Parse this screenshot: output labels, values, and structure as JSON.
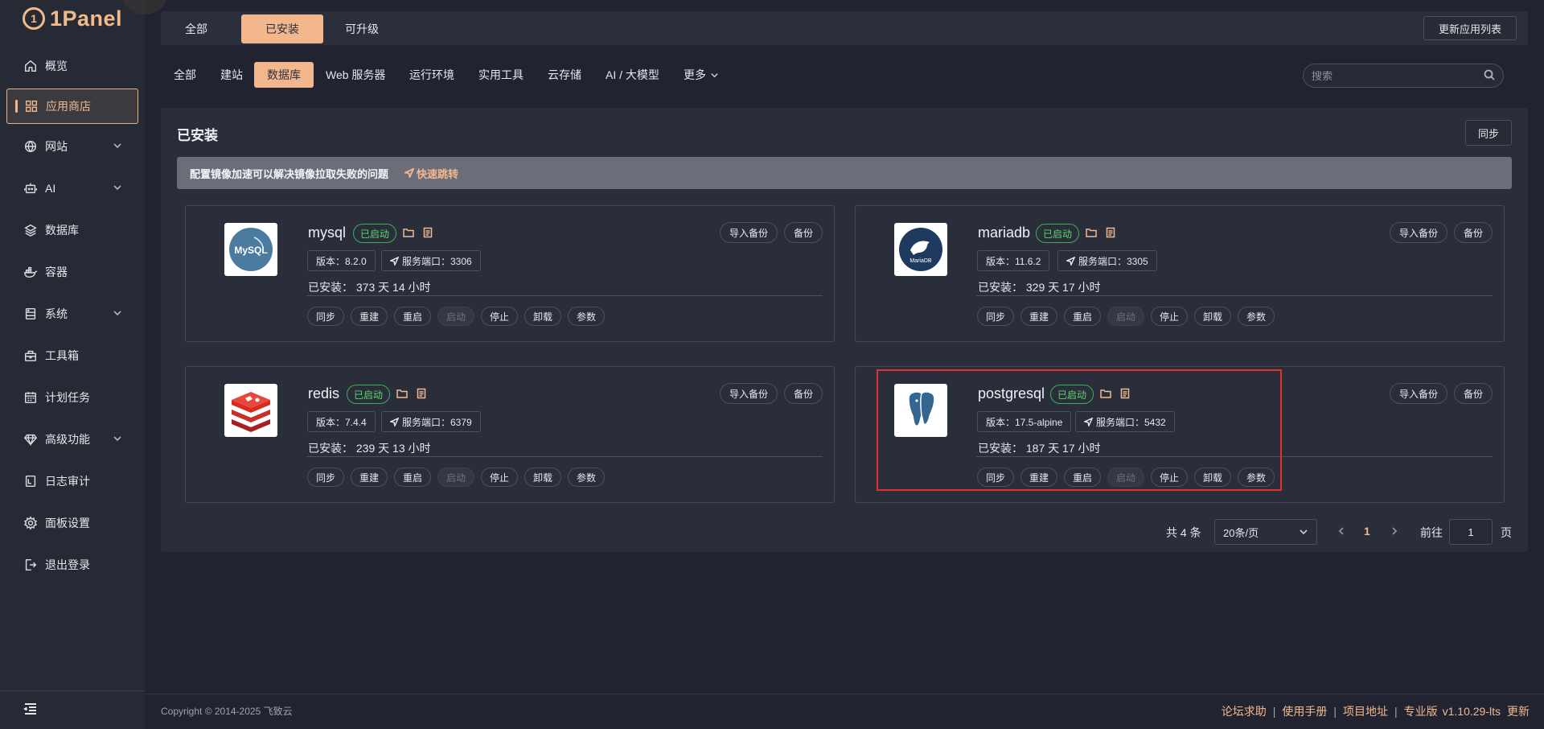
{
  "brand": {
    "name": "1Panel"
  },
  "sidebar": {
    "items": [
      {
        "label": "概览"
      },
      {
        "label": "应用商店"
      },
      {
        "label": "网站"
      },
      {
        "label": "AI"
      },
      {
        "label": "数据库"
      },
      {
        "label": "容器"
      },
      {
        "label": "系统"
      },
      {
        "label": "工具箱"
      },
      {
        "label": "计划任务"
      },
      {
        "label": "高级功能"
      },
      {
        "label": "日志审计"
      },
      {
        "label": "面板设置"
      },
      {
        "label": "退出登录"
      }
    ]
  },
  "top_tabs": {
    "all": "全部",
    "installed": "已安装",
    "upgradable": "可升级",
    "update_list": "更新应用列表"
  },
  "categories": {
    "items": [
      "全部",
      "建站",
      "数据库",
      "Web 服务器",
      "运行环境",
      "实用工具",
      "云存储",
      "AI / 大模型",
      "更多"
    ],
    "search_placeholder": "搜索"
  },
  "panel": {
    "title": "已安装",
    "sync_label": "同步",
    "notice_text": "配置镜像加速可以解决镜像拉取失败的问题",
    "notice_link": "快速跳转"
  },
  "apps": [
    {
      "name": "mysql",
      "status": "已启动",
      "version": "版本：8.2.0",
      "port": "服务端口：3306",
      "installed": "已安装：  373 天 14 小时"
    },
    {
      "name": "mariadb",
      "status": "已启动",
      "version": "版本：11.6.2",
      "port": "服务端口：3305",
      "installed": "已安装：  329 天 17 小时"
    },
    {
      "name": "redis",
      "status": "已启动",
      "version": "版本：7.4.4",
      "port": "服务端口：6379",
      "installed": "已安装：  239 天 13 小时"
    },
    {
      "name": "postgresql",
      "status": "已启动",
      "version": "版本：17.5-alpine",
      "port": "服务端口：5432",
      "installed": "已安装：  187 天 17 小时"
    }
  ],
  "card_actions": {
    "import_backup": "导入备份",
    "backup": "备份",
    "sync": "同步",
    "rebuild": "重建",
    "restart": "重启",
    "start": "启动",
    "stop": "停止",
    "uninstall": "卸载",
    "params": "参数"
  },
  "logos": {
    "mysql": "MySQL",
    "mariadb": "MariaDB"
  },
  "pagination": {
    "total": "共 4 条",
    "page_size": "20条/页",
    "current_page": "1",
    "goto": "前往",
    "goto_value": "1",
    "unit": "页"
  },
  "footer": {
    "copyright": "Copyright © 2014-2025 飞致云",
    "links": [
      "论坛求助",
      "使用手册",
      "项目地址",
      "专业版",
      "v1.10.29-lts",
      "更新"
    ]
  },
  "colors": {
    "accent": "#f3b78e",
    "status_green": "#5ed36f",
    "highlight": "#e03030"
  }
}
